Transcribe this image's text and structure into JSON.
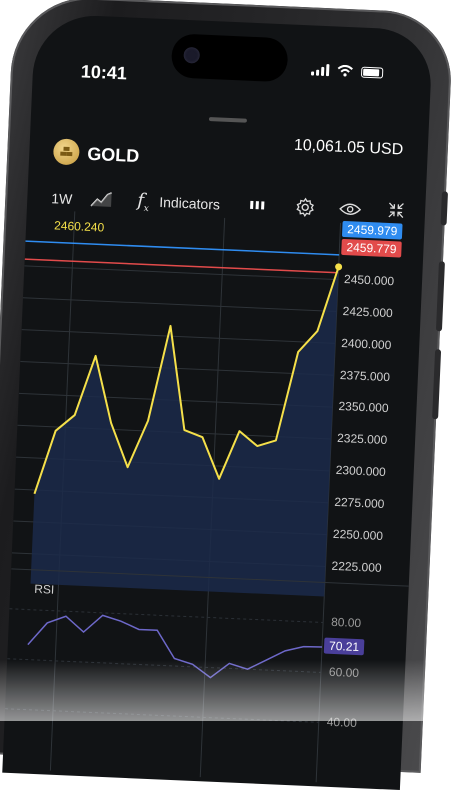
{
  "status_bar": {
    "time": "10:41"
  },
  "asset": {
    "name": "GOLD",
    "balance": "10,061.05 USD",
    "icon": "gold-bars-icon"
  },
  "toolbar": {
    "timeframe": "1W",
    "chart_type_icon": "area-chart-icon",
    "indicators_icon": "function-icon",
    "indicators_label": "Indicators",
    "candles_icon": "candles-icon",
    "settings_icon": "gear-icon",
    "visibility_icon": "eye-icon",
    "collapse_icon": "collapse-icon"
  },
  "price_chart": {
    "left_label": "2460.240",
    "blue_tag": "2459.979",
    "red_tag": "2459.779",
    "colors": {
      "line": "#f5e04a",
      "blue": "#2f8cf0",
      "red": "#e24b4b",
      "fill": "#1b2a4a"
    }
  },
  "chart_data": [
    {
      "type": "line",
      "x": [
        1,
        2,
        3,
        4,
        5,
        6,
        7,
        8,
        9,
        10,
        11,
        12,
        13,
        14,
        15,
        16,
        17
      ],
      "values": [
        2272,
        2322,
        2335,
        2382,
        2330,
        2296,
        2333,
        2408,
        2327,
        2322,
        2290,
        2328,
        2317,
        2322,
        2392,
        2409,
        2460
      ],
      "yticks": [
        "2450.000",
        "2425.000",
        "2400.000",
        "2375.000",
        "2350.000",
        "2325.000",
        "2300.000",
        "2275.000",
        "2250.000",
        "2225.000"
      ],
      "ylim": [
        2225,
        2460
      ],
      "grid": true
    },
    {
      "type": "line",
      "title": "RSI",
      "values": [
        66,
        75,
        78,
        72,
        79,
        77,
        74,
        74,
        63,
        61,
        56,
        62,
        60,
        64,
        68,
        70,
        70.21
      ],
      "yticks": [
        "80.00",
        "60.00",
        "40.00"
      ],
      "current_label": "70.21",
      "ylim": [
        40,
        80
      ]
    }
  ]
}
